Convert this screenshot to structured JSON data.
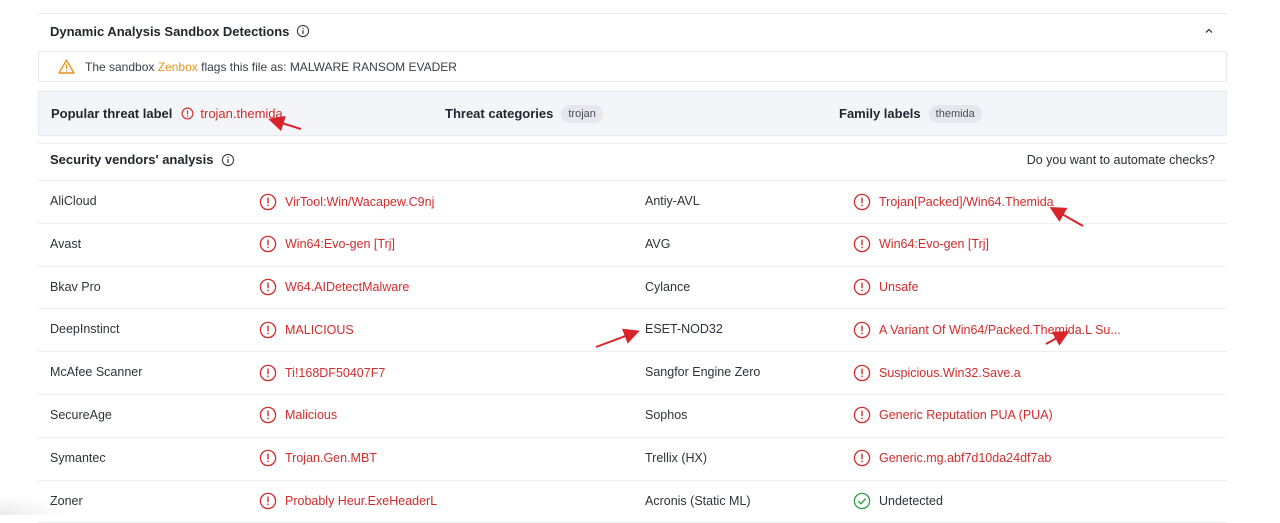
{
  "sandbox": {
    "title": "Dynamic Analysis Sandbox Detections",
    "alert_prefix": "The sandbox",
    "sandbox_name": "Zenbox",
    "alert_suffix": "flags this file as: MALWARE RANSOM EVADER"
  },
  "threat": {
    "popular_label": "Popular threat label",
    "popular_value": "trojan.themida",
    "categories_label": "Threat categories",
    "categories_value": "trojan",
    "family_label": "Family labels",
    "family_value": "themida"
  },
  "vendors": {
    "title": "Security vendors' analysis",
    "automate_text": "Do you want to automate checks?",
    "rows": [
      {
        "left_vendor": "AliCloud",
        "left_result": "VirTool:Win/Wacapew.C9nj",
        "right_vendor": "Antiy-AVL",
        "right_result": "Trojan[Packed]/Win64.Themida"
      },
      {
        "left_vendor": "Avast",
        "left_result": "Win64:Evo-gen [Trj]",
        "right_vendor": "AVG",
        "right_result": "Win64:Evo-gen [Trj]"
      },
      {
        "left_vendor": "Bkav Pro",
        "left_result": "W64.AIDetectMalware",
        "right_vendor": "Cylance",
        "right_result": "Unsafe"
      },
      {
        "left_vendor": "DeepInstinct",
        "left_result": "MALICIOUS",
        "right_vendor": "ESET-NOD32",
        "right_result": "A Variant Of Win64/Packed.Themida.L Su..."
      },
      {
        "left_vendor": "McAfee Scanner",
        "left_result": "Ti!168DF50407F7",
        "right_vendor": "Sangfor Engine Zero",
        "right_result": "Suspicious.Win32.Save.a"
      },
      {
        "left_vendor": "SecureAge",
        "left_result": "Malicious",
        "right_vendor": "Sophos",
        "right_result": "Generic Reputation PUA (PUA)"
      },
      {
        "left_vendor": "Symantec",
        "left_result": "Trojan.Gen.MBT",
        "right_vendor": "Trellix (HX)",
        "right_result": "Generic.mg.abf7d10da24df7ab"
      },
      {
        "left_vendor": "Zoner",
        "left_result": "Probably Heur.ExeHeaderL",
        "right_vendor": "Acronis (Static ML)",
        "right_result": "Undetected"
      }
    ]
  },
  "colors": {
    "malicious": "#d22c2c",
    "clean": "#2e9e4a",
    "warning": "#e5941f"
  },
  "icons": {
    "detected": "alert-circle-icon",
    "undetected": "check-circle-icon",
    "info": "info-icon",
    "warning": "warning-triangle-icon",
    "collapse": "chevron-up-icon"
  }
}
